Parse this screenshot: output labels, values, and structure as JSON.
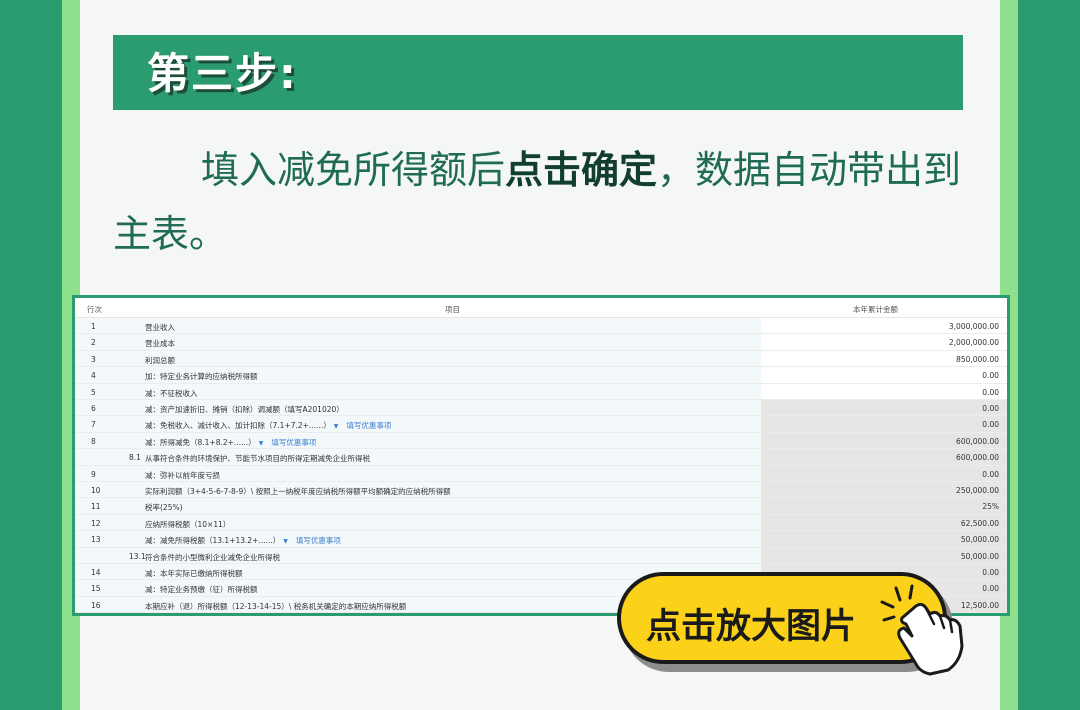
{
  "step": {
    "title": "第三步:"
  },
  "intro": {
    "prefix": "填入减免所得额后",
    "emphasis": "点击确定",
    "suffix": "，数据自动带出到主表。"
  },
  "table": {
    "headers": {
      "line": "行次",
      "item": "项目",
      "amount": "本年累计金额"
    },
    "rows": [
      {
        "no": "1",
        "sub": "",
        "item": "营业收入",
        "link": "",
        "amount": "3,000,000.00",
        "amount_bg": "white"
      },
      {
        "no": "2",
        "sub": "",
        "item": "营业成本",
        "link": "",
        "amount": "2,000,000.00",
        "amount_bg": "white"
      },
      {
        "no": "3",
        "sub": "",
        "item": "利润总额",
        "link": "",
        "amount": "850,000.00",
        "amount_bg": "white"
      },
      {
        "no": "4",
        "sub": "",
        "item": "加：特定业务计算的应纳税所得额",
        "link": "",
        "amount": "0.00",
        "amount_bg": "white"
      },
      {
        "no": "5",
        "sub": "",
        "item": "减：不征税收入",
        "link": "",
        "amount": "0.00",
        "amount_bg": "white"
      },
      {
        "no": "6",
        "sub": "",
        "item": "减：资产加速折旧、摊销（扣除）调减额（填写A201020）",
        "link": "",
        "amount": "0.00",
        "amount_bg": "grey"
      },
      {
        "no": "7",
        "sub": "",
        "item": "减：免税收入、减计收入、加计扣除（7.1+7.2+......）",
        "link": "填写优惠事项",
        "amount": "0.00",
        "amount_bg": "grey"
      },
      {
        "no": "8",
        "sub": "",
        "item": "减：所得减免（8.1+8.2+......）",
        "link": "填写优惠事项",
        "amount": "600,000.00",
        "amount_bg": "grey"
      },
      {
        "no": "",
        "sub": "8.1",
        "item": "从事符合条件的环境保护、节能节水项目的所得定期减免企业所得税",
        "link": "",
        "amount": "600,000.00",
        "amount_bg": "grey"
      },
      {
        "no": "9",
        "sub": "",
        "item": "减：弥补以前年度亏损",
        "link": "",
        "amount": "0.00",
        "amount_bg": "grey"
      },
      {
        "no": "10",
        "sub": "",
        "item": "实际利润额（3+4-5-6-7-8-9）\\ 按照上一纳税年度应纳税所得额平均额确定的应纳税所得额",
        "link": "",
        "amount": "250,000.00",
        "amount_bg": "grey"
      },
      {
        "no": "11",
        "sub": "",
        "item": "税率(25%)",
        "link": "",
        "amount": "25%",
        "amount_bg": "grey"
      },
      {
        "no": "12",
        "sub": "",
        "item": "应纳所得税额（10×11）",
        "link": "",
        "amount": "62,500.00",
        "amount_bg": "grey"
      },
      {
        "no": "13",
        "sub": "",
        "item": "减：减免所得税额（13.1+13.2+......）",
        "link": "填写优惠事项",
        "amount": "50,000.00",
        "amount_bg": "grey"
      },
      {
        "no": "",
        "sub": "13.1",
        "item": "符合条件的小型微利企业减免企业所得税",
        "link": "",
        "amount": "50,000.00",
        "amount_bg": "grey"
      },
      {
        "no": "14",
        "sub": "",
        "item": "减：本年实际已缴纳所得税额",
        "link": "",
        "amount": "0.00",
        "amount_bg": "grey"
      },
      {
        "no": "15",
        "sub": "",
        "item": "减：特定业务预缴（征）所得税额",
        "link": "",
        "amount": "0.00",
        "amount_bg": "grey"
      },
      {
        "no": "16",
        "sub": "",
        "item": "本期应补（退）所得税额（12-13-14-15）\\ 税务机关确定的本期应纳所得税额",
        "link": "",
        "amount": "12,500.00",
        "amount_bg": "grey"
      }
    ]
  },
  "cta": {
    "label": "点击放大图片"
  },
  "colors": {
    "green": "#2a9c70",
    "light_green": "#8fe08c",
    "yellow": "#fcd11a",
    "text_green": "#1f6b55"
  }
}
